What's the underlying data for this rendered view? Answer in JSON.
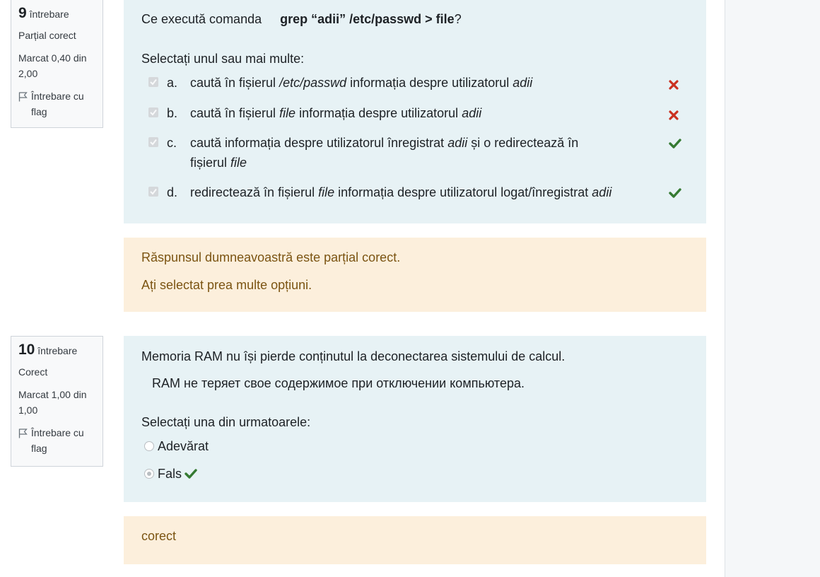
{
  "questions": [
    {
      "number": "9",
      "word": "întrebare",
      "state": "Parțial corect",
      "grade": "Marcat 0,40 din 2,00",
      "flag_label": "Întrebare cu flag",
      "text_prefix": "Ce execută comanda",
      "command": "grep “adii” /etc/passwd > file",
      "text_suffix": "?",
      "prompt": "Selectați unul sau mai multe:",
      "answers": [
        {
          "letter": "a.",
          "parts": [
            "caută în fișierul ",
            "/etc/passwd",
            " informația despre utilizatorul ",
            "adii",
            ""
          ],
          "checked": true,
          "result": "incorrect"
        },
        {
          "letter": "b.",
          "parts": [
            "caută în fișierul ",
            "file",
            " informația despre utilizatorul ",
            "adii",
            ""
          ],
          "checked": true,
          "result": "incorrect"
        },
        {
          "letter": "c.",
          "parts": [
            "caută informația despre utilizatorul înregistrat ",
            "adii",
            " și o redirectează în fișierul ",
            "file",
            ""
          ],
          "checked": true,
          "result": "correct"
        },
        {
          "letter": "d.",
          "parts": [
            "redirectează în fișierul ",
            "file",
            " informația despre utilizatorul logat/înregistrat ",
            "adii",
            ""
          ],
          "checked": true,
          "result": "correct"
        }
      ],
      "feedback": [
        "Răspunsul dumneavoastră este parțial corect.",
        "Ați selectat prea multe opțiuni."
      ]
    },
    {
      "number": "10",
      "word": "întrebare",
      "state": "Corect",
      "grade": "Marcat 1,00 din 1,00",
      "flag_label": "Întrebare cu flag",
      "text_ro": "Memoria RAM nu își pierde conținutul la deconectarea sistemului de calcul.",
      "text_ru": "RAM не теряет свое содержимое при отключении компьютера.",
      "prompt": "Selectați una din urmatoarele:",
      "options": [
        {
          "label": "Adevărat",
          "selected": false,
          "result": ""
        },
        {
          "label": "Fals",
          "selected": true,
          "result": "correct"
        }
      ],
      "feedback": [
        "corect"
      ]
    }
  ],
  "colors": {
    "formulation_bg": "#e7f2f5",
    "feedback_bg": "#fcefdc",
    "feedback_text": "#7b5412",
    "correct": "#357a32",
    "incorrect": "#ca3120"
  },
  "icons": {
    "flag": "flag-icon",
    "correct": "check-icon",
    "incorrect": "cross-icon",
    "checkbox": "checkbox-checked-icon"
  }
}
